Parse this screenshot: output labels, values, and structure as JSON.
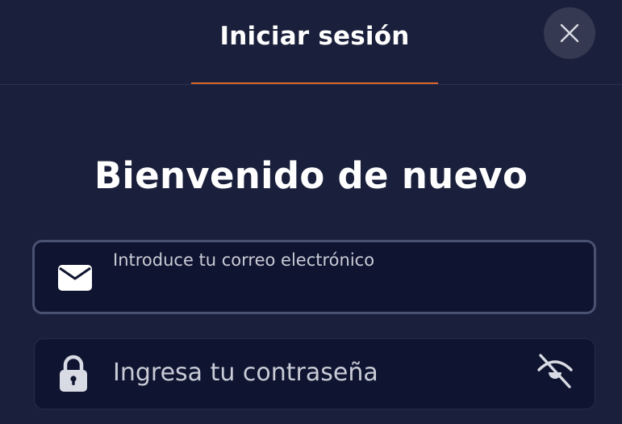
{
  "header": {
    "tab_label": "Iniciar sesión",
    "active_tab_color": "#e0672b"
  },
  "close_icon": "close-icon",
  "main": {
    "title": "Bienvenido de nuevo",
    "email": {
      "label": "Introduce tu correo electrónico",
      "value": "",
      "icon": "mail-icon"
    },
    "password": {
      "placeholder": "Ingresa tu contraseña",
      "value": "",
      "icon": "lock-icon",
      "toggle_icon": "eye-off-icon"
    }
  },
  "colors": {
    "background": "#1a1f3b",
    "field_background": "#0f1430",
    "close_button_background": "#353a52"
  }
}
